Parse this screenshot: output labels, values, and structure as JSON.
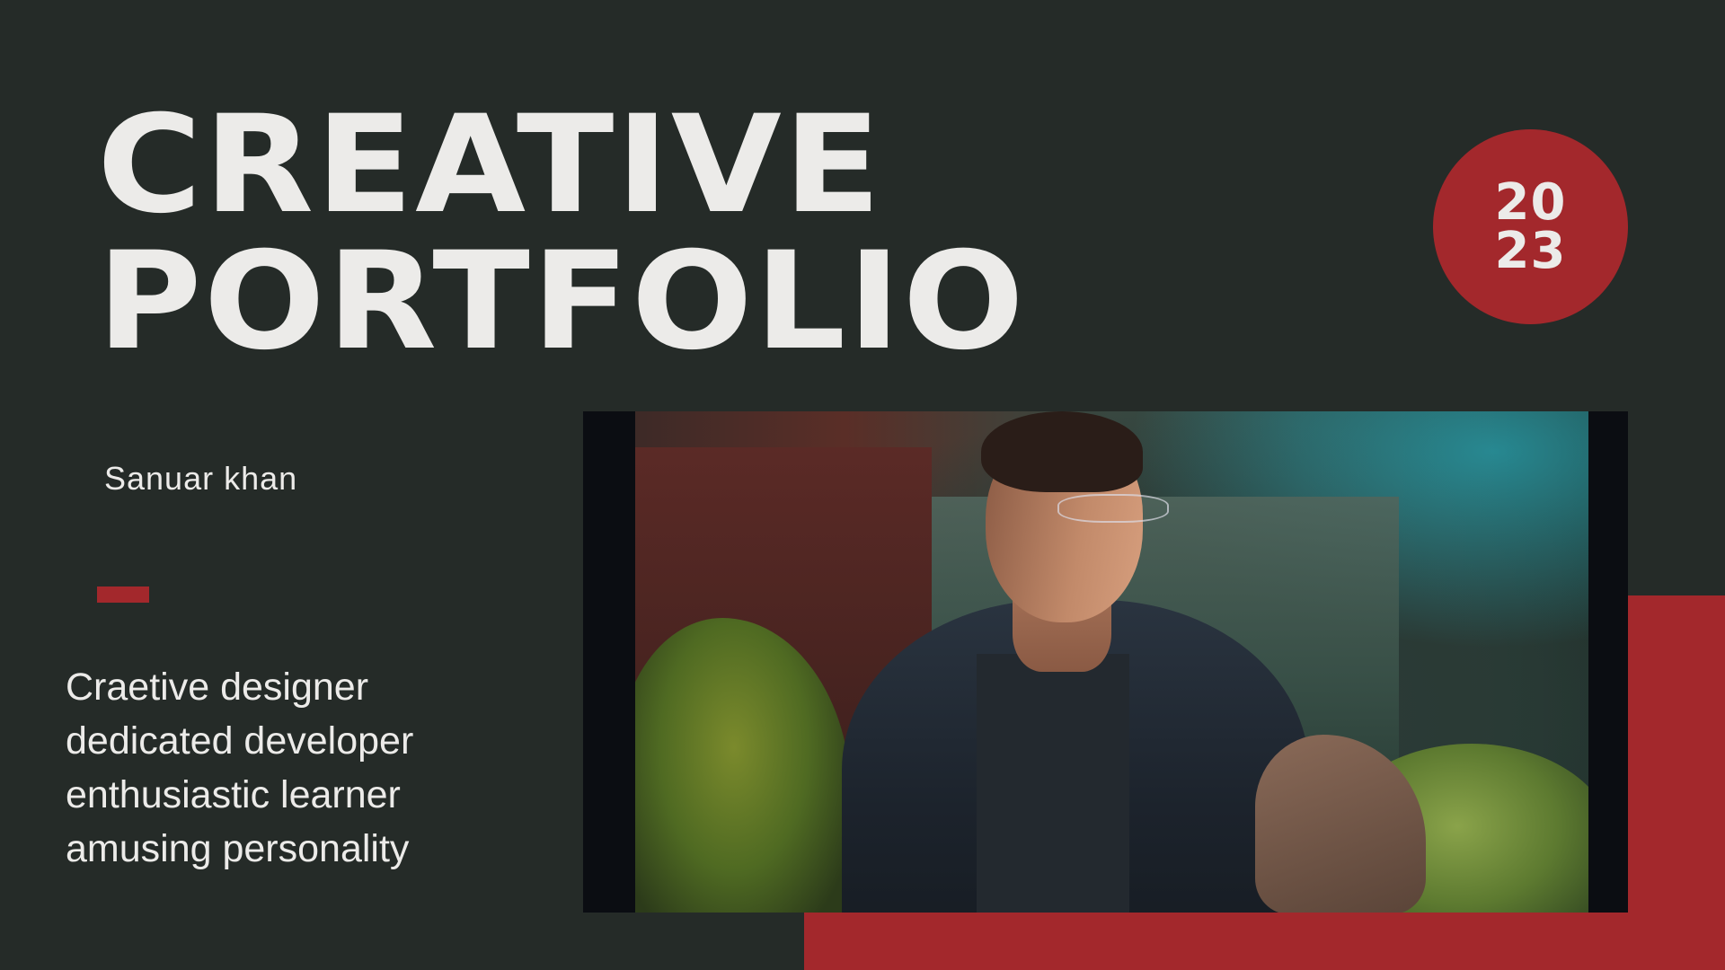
{
  "title": {
    "line1": "CREATIVE",
    "line2": "PORTFOLIO"
  },
  "year": {
    "top": "20",
    "bottom": "23"
  },
  "author": "Sanuar khan",
  "taglines": [
    "Craetive designer",
    "dedicated developer",
    "enthusiastic learner",
    "amusing personality"
  ],
  "colors": {
    "background": "#252b28",
    "accent": "#a3282c",
    "text": "#ecebe9"
  }
}
